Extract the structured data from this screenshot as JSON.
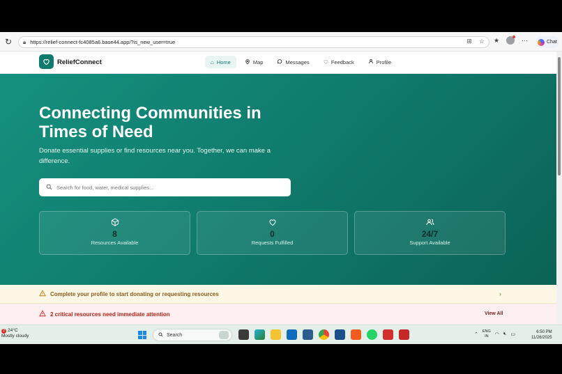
{
  "browser": {
    "url": "https://relief-connect-fc4085a6.base44.app/?is_new_user=true",
    "chat_label": "Chat"
  },
  "site": {
    "brand": "ReliefConnect",
    "nav": [
      {
        "label": "Home",
        "icon": "home-icon",
        "active": true
      },
      {
        "label": "Map",
        "icon": "map-pin-icon",
        "active": false
      },
      {
        "label": "Messages",
        "icon": "message-icon",
        "active": false
      },
      {
        "label": "Feedback",
        "icon": "heart-icon",
        "active": false
      },
      {
        "label": "Profile",
        "icon": "user-icon",
        "active": false
      }
    ]
  },
  "hero": {
    "title": "Connecting Communities in Times of Need",
    "subtitle": "Donate essential supplies or find resources near you. Together, we can make a difference.",
    "search_placeholder": "Search for food, water, medical supplies..."
  },
  "stats": [
    {
      "icon": "box-icon",
      "value": "8",
      "label": "Resources Available"
    },
    {
      "icon": "heart-icon",
      "value": "0",
      "label": "Requests Fulfilled"
    },
    {
      "icon": "users-icon",
      "value": "24/7",
      "label": "Support Available"
    }
  ],
  "alerts": {
    "profile": "Complete your profile to start donating or requesting resources",
    "critical": "2 critical resources need immediate attention",
    "view_all": "View All"
  },
  "taskbar": {
    "temp": "24°C",
    "weather": "Mostly cloudy",
    "weather_badge": "2",
    "search": "Search",
    "lang1": "ENG",
    "lang2": "IN",
    "time": "6:50 PM",
    "date": "11/26/2025"
  },
  "colors": {
    "brand": "#107a6c",
    "hero_start": "#15917f",
    "hero_end": "#0b6355",
    "warning": "#8a5a1a",
    "danger": "#b42318"
  }
}
